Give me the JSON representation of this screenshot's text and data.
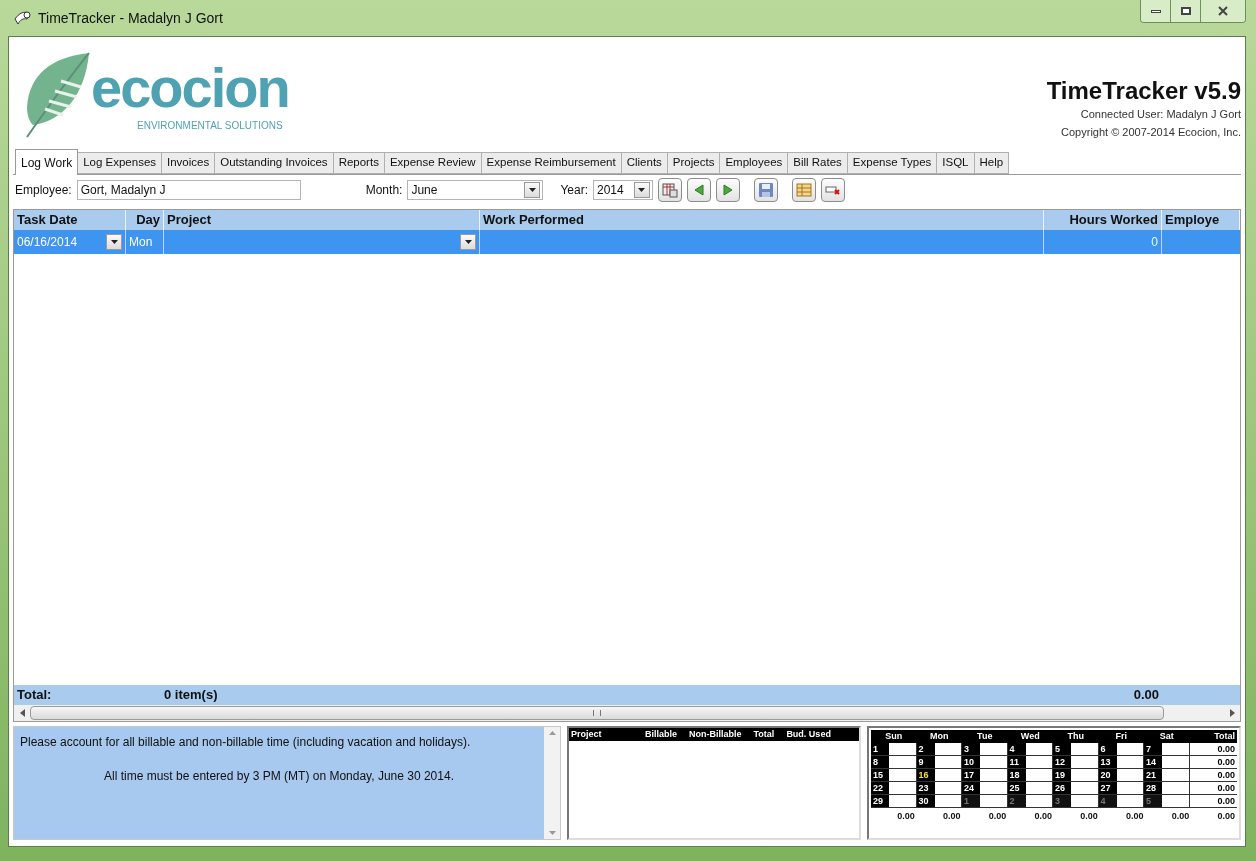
{
  "window": {
    "title": "TimeTracker - Madalyn J Gort"
  },
  "logo": {
    "name": "ecocion",
    "tagline": "ENVIRONMENTAL SOLUTIONS"
  },
  "app_header": {
    "title": "TimeTracker v5.9",
    "connected_user": "Connected User: Madalyn J Gort",
    "copyright": "Copyright © 2007-2014 Ecocion, Inc."
  },
  "tabs": [
    {
      "label": "Log Work",
      "selected": true
    },
    {
      "label": "Log Expenses",
      "selected": false
    },
    {
      "label": "Invoices",
      "selected": false
    },
    {
      "label": "Outstanding Invoices",
      "selected": false
    },
    {
      "label": "Reports",
      "selected": false
    },
    {
      "label": "Expense Review",
      "selected": false
    },
    {
      "label": "Expense Reimbursement",
      "selected": false
    },
    {
      "label": "Clients",
      "selected": false
    },
    {
      "label": "Projects",
      "selected": false
    },
    {
      "label": "Employees",
      "selected": false
    },
    {
      "label": "Bill Rates",
      "selected": false
    },
    {
      "label": "Expense Types",
      "selected": false
    },
    {
      "label": "ISQL",
      "selected": false
    },
    {
      "label": "Help",
      "selected": false
    }
  ],
  "toolbar": {
    "employee_label": "Employee:",
    "employee_value": "Gort, Madalyn J",
    "month_label": "Month:",
    "month_value": "June",
    "year_label": "Year:",
    "year_value": "2014"
  },
  "table": {
    "columns": [
      "Task Date",
      "Day",
      "Project",
      "Work Performed",
      "Hours Worked",
      "Employe"
    ],
    "rows": [
      {
        "task_date": "06/16/2014",
        "day": "Mon",
        "project": "",
        "work": "",
        "hours": "0",
        "selected": true
      }
    ],
    "total_label": "Total:",
    "total_count": "0 item(s)",
    "total_hours": "0.00"
  },
  "notes": [
    "Please account for all billable and non-billable time (including vacation and holidays).",
    "All time must be entered by 3 PM (MT) on Monday, June 30 2014."
  ],
  "summary": {
    "columns": [
      "Project",
      "Billable",
      "Non-Billable",
      "Total",
      "Bud. Used"
    ]
  },
  "calendar": {
    "headers": [
      "Sun",
      "Mon",
      "Tue",
      "Wed",
      "Thu",
      "Fri",
      "Sat",
      "Total"
    ],
    "weeks": [
      {
        "days": [
          {
            "day": "1",
            "outside_month": false,
            "today": false
          },
          {
            "day": "2",
            "outside_month": false,
            "today": false
          },
          {
            "day": "3",
            "outside_month": false,
            "today": false
          },
          {
            "day": "4",
            "outside_month": false,
            "today": false
          },
          {
            "day": "5",
            "outside_month": false,
            "today": false
          },
          {
            "day": "6",
            "outside_month": false,
            "today": false
          },
          {
            "day": "7",
            "outside_month": false,
            "today": false
          }
        ],
        "total": "0.00"
      },
      {
        "days": [
          {
            "day": "8",
            "outside_month": false,
            "today": false
          },
          {
            "day": "9",
            "outside_month": false,
            "today": false
          },
          {
            "day": "10",
            "outside_month": false,
            "today": false
          },
          {
            "day": "11",
            "outside_month": false,
            "today": false
          },
          {
            "day": "12",
            "outside_month": false,
            "today": false
          },
          {
            "day": "13",
            "outside_month": false,
            "today": false
          },
          {
            "day": "14",
            "outside_month": false,
            "today": false
          }
        ],
        "total": "0.00"
      },
      {
        "days": [
          {
            "day": "15",
            "outside_month": false,
            "today": false
          },
          {
            "day": "16",
            "outside_month": false,
            "today": true
          },
          {
            "day": "17",
            "outside_month": false,
            "today": false
          },
          {
            "day": "18",
            "outside_month": false,
            "today": false
          },
          {
            "day": "19",
            "outside_month": false,
            "today": false
          },
          {
            "day": "20",
            "outside_month": false,
            "today": false
          },
          {
            "day": "21",
            "outside_month": false,
            "today": false
          }
        ],
        "total": "0.00"
      },
      {
        "days": [
          {
            "day": "22",
            "outside_month": false,
            "today": false
          },
          {
            "day": "23",
            "outside_month": false,
            "today": false
          },
          {
            "day": "24",
            "outside_month": false,
            "today": false
          },
          {
            "day": "25",
            "outside_month": false,
            "today": false
          },
          {
            "day": "26",
            "outside_month": false,
            "today": false
          },
          {
            "day": "27",
            "outside_month": false,
            "today": false
          },
          {
            "day": "28",
            "outside_month": false,
            "today": false
          }
        ],
        "total": "0.00"
      },
      {
        "days": [
          {
            "day": "29",
            "outside_month": false,
            "today": false
          },
          {
            "day": "30",
            "outside_month": false,
            "today": false
          },
          {
            "day": "1",
            "outside_month": true,
            "today": false
          },
          {
            "day": "2",
            "outside_month": true,
            "today": false
          },
          {
            "day": "3",
            "outside_month": true,
            "today": false
          },
          {
            "day": "4",
            "outside_month": true,
            "today": false
          },
          {
            "day": "5",
            "outside_month": true,
            "today": false
          }
        ],
        "total": "0.00"
      }
    ],
    "column_totals": [
      "0.00",
      "0.00",
      "0.00",
      "0.00",
      "0.00",
      "0.00",
      "0.00",
      "0.00"
    ]
  }
}
